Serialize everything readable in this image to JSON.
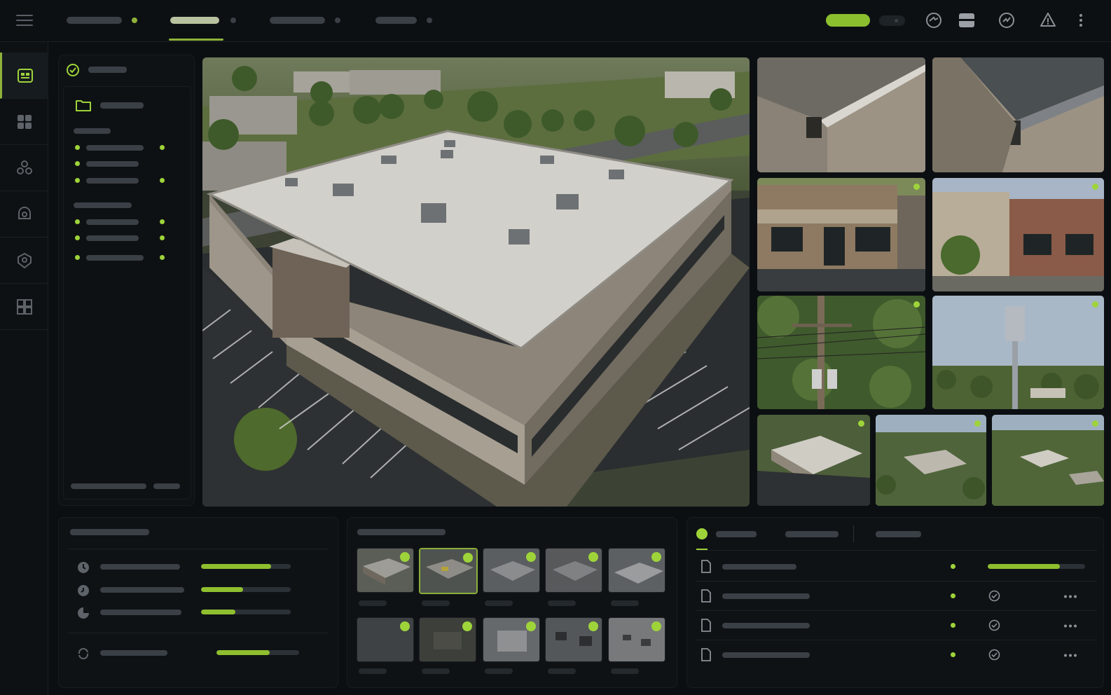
{
  "theme": {
    "accent": "#8fbf2e",
    "accent_dot": "#9ed43a",
    "background": "#0c0f12",
    "panel": "#0f1215",
    "placeholder": "#3a4046"
  },
  "topbar": {
    "icons": [
      "menu-icon",
      "globe-arrow-icon",
      "panel-layout-icon",
      "refresh-globe-icon",
      "alert-cloud-icon",
      "more-vertical-icon"
    ],
    "tabs": [
      {
        "active": false
      },
      {
        "active": true
      },
      {
        "active": false
      },
      {
        "active": false
      }
    ]
  },
  "rail": {
    "icons": [
      "dashboard-icon",
      "grid-icon",
      "users-icon",
      "search-map-icon",
      "shield-icon",
      "layout-icon"
    ],
    "active_index": 0
  },
  "file_panel": {
    "icons": [
      "check-circle-icon",
      "folder-icon"
    ]
  },
  "metrics": {
    "progress": [
      0.78,
      0.47,
      0.38
    ],
    "summary_progress": 0.64
  },
  "files": {
    "progress": 0.74,
    "rows": 4
  }
}
